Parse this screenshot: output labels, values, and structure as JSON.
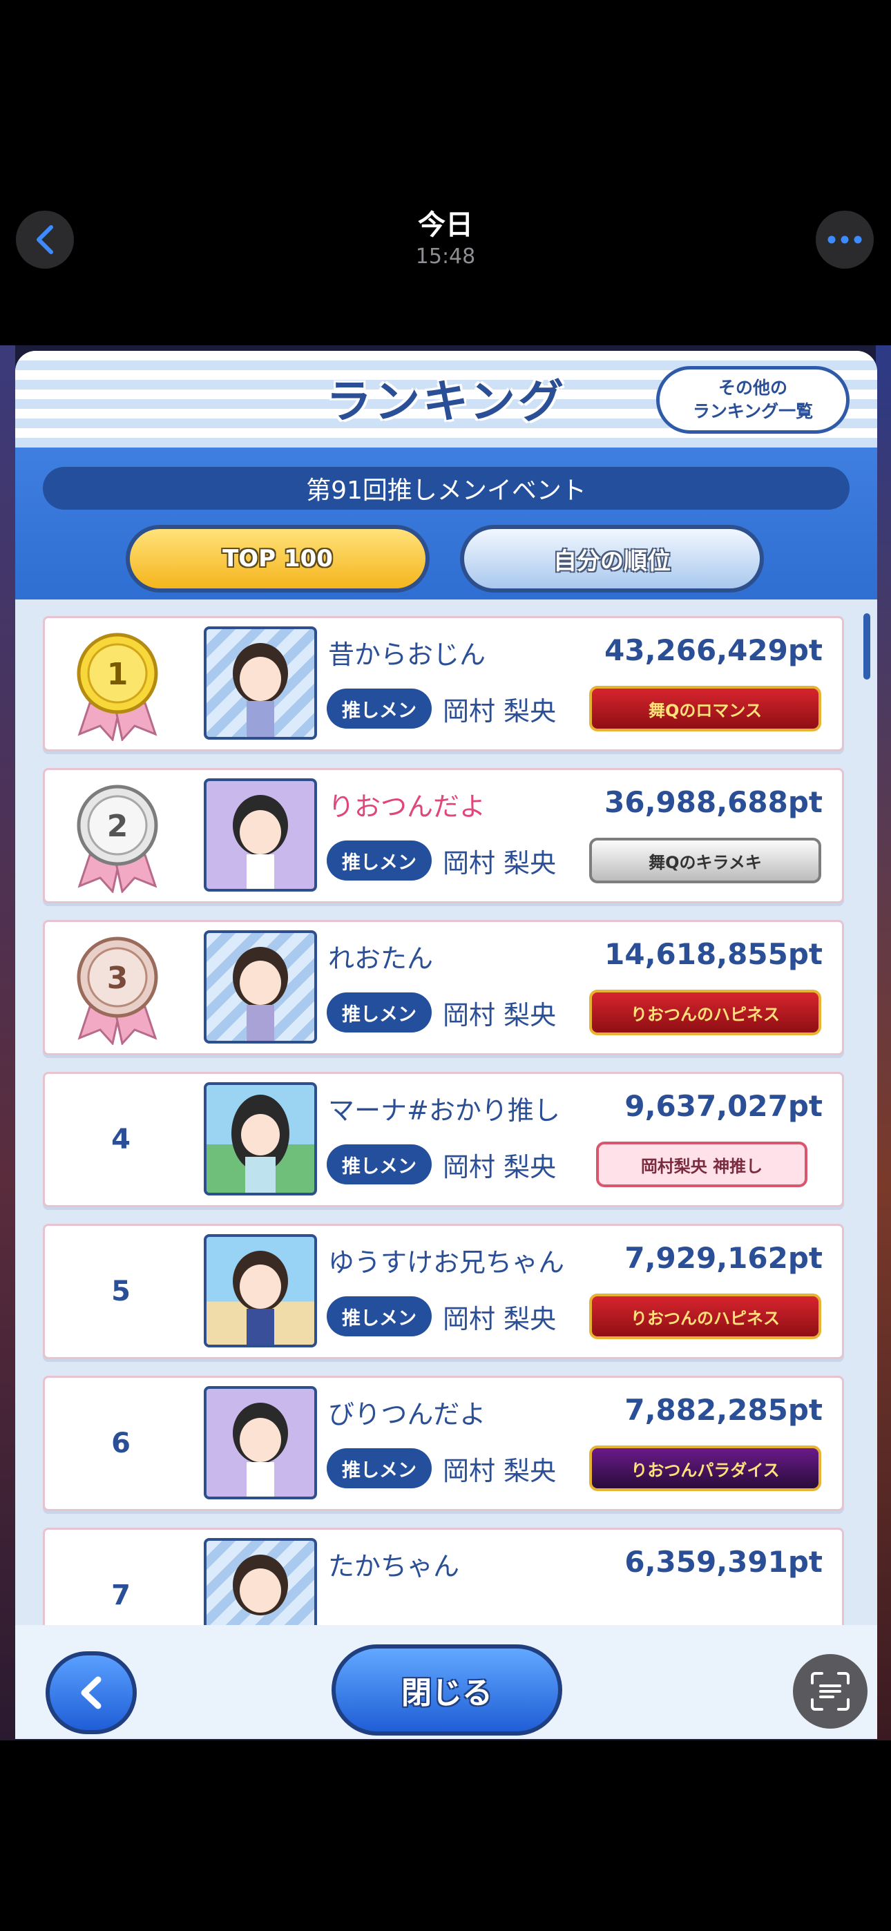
{
  "nav": {
    "title": "今日",
    "time": "15:48"
  },
  "panel": {
    "title": "ランキング",
    "other_button": "その他の\nランキング一覧",
    "event_name": "第91回推しメンイベント",
    "tabs": [
      {
        "label": "TOP 100",
        "active": true
      },
      {
        "label": "自分の順位",
        "active": false
      }
    ]
  },
  "rows": [
    {
      "rank": "1",
      "name": "昔からおじん",
      "points": "43,266,429pt",
      "badge": "推しメン",
      "member": "岡村 梨央",
      "title": "舞Qのロマンス",
      "title_style": "red",
      "name_color": "#2b4f96"
    },
    {
      "rank": "2",
      "name": "りおつんだよ",
      "points": "36,988,688pt",
      "badge": "推しメン",
      "member": "岡村 梨央",
      "title": "舞Qのキラメキ",
      "title_style": "silver",
      "name_color": "#e0457c"
    },
    {
      "rank": "3",
      "name": "れおたん",
      "points": "14,618,855pt",
      "badge": "推しメン",
      "member": "岡村 梨央",
      "title": "りおつんのハピネス",
      "title_style": "red",
      "name_color": "#2b4f96"
    },
    {
      "rank": "4",
      "name": "マーナ#おかり推し",
      "points": "9,637,027pt",
      "badge": "推しメン",
      "member": "岡村 梨央",
      "title": "岡村梨央 神推し",
      "title_style": "pink",
      "name_color": "#2b4f96"
    },
    {
      "rank": "5",
      "name": "ゆうすけお兄ちゃん",
      "points": "7,929,162pt",
      "badge": "推しメン",
      "member": "岡村 梨央",
      "title": "りおつんのハピネス",
      "title_style": "red",
      "name_color": "#2b4f96"
    },
    {
      "rank": "6",
      "name": "びりつんだよ",
      "points": "7,882,285pt",
      "badge": "推しメン",
      "member": "岡村 梨央",
      "title": "りおつんパラダイス",
      "title_style": "dark",
      "name_color": "#2b4f96"
    },
    {
      "rank": "7",
      "name": "たかちゃん",
      "points": "6,359,391pt",
      "badge": "",
      "member": "",
      "title": "",
      "title_style": "none",
      "name_color": "#2b4f96"
    }
  ],
  "bottom": {
    "close_label": "閉じる"
  },
  "colors": {
    "accent": "#2b4f96",
    "gold": "#f5b51d",
    "blue": "#2f6ed2"
  }
}
